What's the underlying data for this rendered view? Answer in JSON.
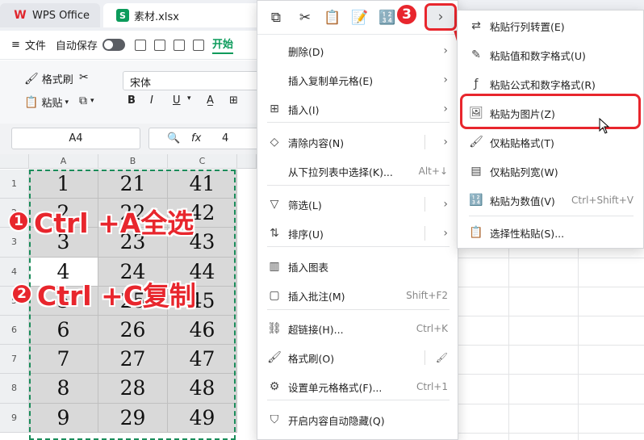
{
  "titlebar": {
    "app_tab": "WPS Office",
    "file_tab": "素材.xlsx",
    "app_logo": "W",
    "file_logo": "S"
  },
  "menubar": {
    "file": "文件",
    "autosave": "自动保存",
    "start_tab": "开始"
  },
  "ribbon": {
    "format_painter": "格式刷",
    "paste": "粘贴",
    "font": "宋体",
    "bold": "B",
    "italic": "I",
    "underline": "U"
  },
  "formula": {
    "cell_ref": "A4",
    "fx": "fx",
    "value": "4"
  },
  "grid": {
    "columns": [
      "A",
      "B",
      "C"
    ],
    "rows": [
      "1",
      "2",
      "3",
      "4",
      "5",
      "6",
      "7",
      "8",
      "9"
    ],
    "cells": [
      [
        "1",
        "21",
        "41"
      ],
      [
        "2",
        "22",
        "42"
      ],
      [
        "3",
        "23",
        "43"
      ],
      [
        "4",
        "24",
        "44"
      ],
      [
        "5",
        "25",
        "45"
      ],
      [
        "6",
        "26",
        "46"
      ],
      [
        "7",
        "27",
        "47"
      ],
      [
        "8",
        "28",
        "48"
      ],
      [
        "9",
        "29",
        "49"
      ]
    ]
  },
  "annotations": {
    "step1_badge": "1",
    "step1_text": "Ctrl +A全选",
    "step2_badge": "2",
    "step2_text": "Ctrl +C复制",
    "step3_badge": "3"
  },
  "context_menu": {
    "items": [
      {
        "label": "删除(D)",
        "shortcut": "",
        "submenu": true
      },
      {
        "label": "插入复制单元格(E)",
        "shortcut": "",
        "submenu": true
      },
      {
        "label": "插入(I)",
        "shortcut": "",
        "submenu": true
      },
      {
        "label": "清除内容(N)",
        "shortcut": "",
        "submenu": true
      },
      {
        "label": "从下拉列表中选择(K)...",
        "shortcut": "Alt+↓",
        "submenu": false
      },
      {
        "label": "筛选(L)",
        "shortcut": "",
        "submenu": true
      },
      {
        "label": "排序(U)",
        "shortcut": "",
        "submenu": true
      },
      {
        "label": "插入图表",
        "shortcut": "",
        "submenu": false
      },
      {
        "label": "插入批注(M)",
        "shortcut": "Shift+F2",
        "submenu": false
      },
      {
        "label": "超链接(H)...",
        "shortcut": "Ctrl+K",
        "submenu": false
      },
      {
        "label": "格式刷(O)",
        "shortcut": "",
        "submenu": false
      },
      {
        "label": "设置单元格格式(F)...",
        "shortcut": "Ctrl+1",
        "submenu": false
      },
      {
        "label": "开启内容自动隐藏(Q)",
        "shortcut": "",
        "submenu": false
      }
    ]
  },
  "paste_submenu": {
    "items": [
      {
        "label": "粘贴行列转置(E)",
        "shortcut": ""
      },
      {
        "label": "粘贴值和数字格式(U)",
        "shortcut": ""
      },
      {
        "label": "粘贴公式和数字格式(R)",
        "shortcut": ""
      },
      {
        "label": "粘贴为图片(Z)",
        "shortcut": ""
      },
      {
        "label": "仅粘贴格式(T)",
        "shortcut": ""
      },
      {
        "label": "仅粘贴列宽(W)",
        "shortcut": ""
      },
      {
        "label": "粘贴为数值(V)",
        "shortcut": "Ctrl+Shift+V"
      },
      {
        "label": "选择性粘贴(S)...",
        "shortcut": ""
      }
    ]
  },
  "colors": {
    "accent_green": "#0c9b5b",
    "annotation_red": "#e8262d",
    "cell_fill": "#d9d9d9"
  }
}
